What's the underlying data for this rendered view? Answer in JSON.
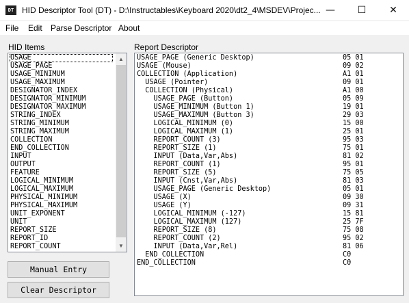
{
  "window": {
    "icon_text": "DT",
    "title": "HID Descriptor Tool (DT) - D:\\Instructables\\Keyboard 2020\\dt2_4\\MSDEV\\Projec...",
    "minimize_glyph": "—",
    "maximize_glyph": "☐",
    "close_glyph": "✕"
  },
  "menu": {
    "file": "File",
    "edit": "Edit",
    "parse": "Parse Descriptor",
    "about": "About"
  },
  "hid_items": {
    "label": "HID Items",
    "items": [
      "USAGE",
      "USAGE_PAGE",
      "USAGE_MINIMUM",
      "USAGE_MAXIMUM",
      "DESIGNATOR_INDEX",
      "DESIGNATOR_MINIMUM",
      "DESIGNATOR_MAXIMUM",
      "STRING_INDEX",
      "STRING_MINIMUM",
      "STRING_MAXIMUM",
      "COLLECTION",
      "END_COLLECTION",
      "INPUT",
      "OUTPUT",
      "FEATURE",
      "LOGICAL_MINIMUM",
      "LOGICAL_MAXIMUM",
      "PHYSICAL_MINIMUM",
      "PHYSICAL_MAXIMUM",
      "UNIT_EXPONENT",
      "UNIT",
      "REPORT_SIZE",
      "REPORT_ID",
      "REPORT_COUNT"
    ],
    "scroll_up_glyph": "▲",
    "scroll_down_glyph": "▼"
  },
  "buttons": {
    "manual_entry": "Manual Entry",
    "clear_descriptor": "Clear Descriptor"
  },
  "report_descriptor": {
    "label": "Report Descriptor",
    "rows": [
      {
        "text": "USAGE_PAGE (Generic Desktop)",
        "hex": "05 01"
      },
      {
        "text": "USAGE (Mouse)",
        "hex": "09 02"
      },
      {
        "text": "COLLECTION (Application)",
        "hex": "A1 01"
      },
      {
        "text": "  USAGE (Pointer)",
        "hex": "09 01"
      },
      {
        "text": "  COLLECTION (Physical)",
        "hex": "A1 00"
      },
      {
        "text": "    USAGE_PAGE (Button)",
        "hex": "05 09"
      },
      {
        "text": "    USAGE_MINIMUM (Button 1)",
        "hex": "19 01"
      },
      {
        "text": "    USAGE_MAXIMUM (Button 3)",
        "hex": "29 03"
      },
      {
        "text": "    LOGICAL_MINIMUM (0)",
        "hex": "15 00"
      },
      {
        "text": "    LOGICAL_MAXIMUM (1)",
        "hex": "25 01"
      },
      {
        "text": "    REPORT_COUNT (3)",
        "hex": "95 03"
      },
      {
        "text": "    REPORT_SIZE (1)",
        "hex": "75 01"
      },
      {
        "text": "    INPUT (Data,Var,Abs)",
        "hex": "81 02"
      },
      {
        "text": "    REPORT_COUNT (1)",
        "hex": "95 01"
      },
      {
        "text": "    REPORT_SIZE (5)",
        "hex": "75 05"
      },
      {
        "text": "    INPUT (Cnst,Var,Abs)",
        "hex": "81 03"
      },
      {
        "text": "    USAGE_PAGE (Generic Desktop)",
        "hex": "05 01"
      },
      {
        "text": "    USAGE (X)",
        "hex": "09 30"
      },
      {
        "text": "    USAGE (Y)",
        "hex": "09 31"
      },
      {
        "text": "    LOGICAL_MINIMUM (-127)",
        "hex": "15 81"
      },
      {
        "text": "    LOGICAL_MAXIMUM (127)",
        "hex": "25 7F"
      },
      {
        "text": "    REPORT_SIZE (8)",
        "hex": "75 08"
      },
      {
        "text": "    REPORT_COUNT (2)",
        "hex": "95 02"
      },
      {
        "text": "    INPUT (Data,Var,Rel)",
        "hex": "81 06"
      },
      {
        "text": "  END_COLLECTION",
        "hex": "C0"
      },
      {
        "text": "END_COLLECTION",
        "hex": "C0"
      }
    ]
  }
}
